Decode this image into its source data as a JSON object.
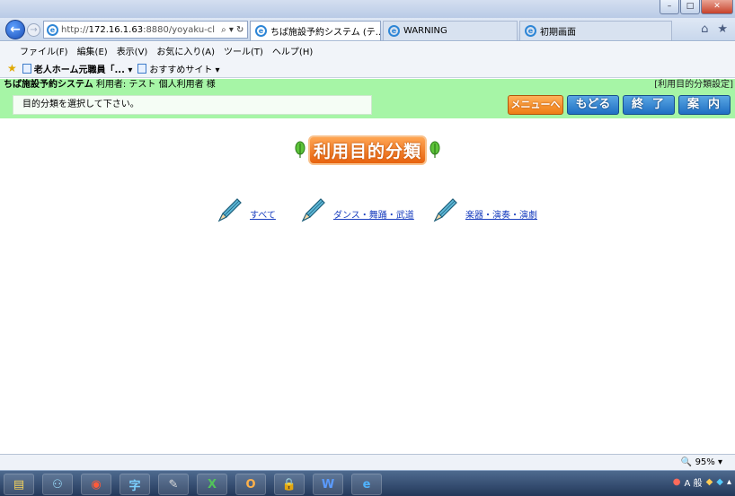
{
  "browser": {
    "address_url_gray": "http://",
    "address_url_host": "172.16.1.63",
    "address_url_rest": ":8880/yoyaku-cl",
    "address_icons": "⌕ ▾ ↻",
    "back_glyph": "←",
    "forward_glyph": "→",
    "tabs": [
      {
        "label": "ちば施設予約システム (テ...",
        "close": "×"
      },
      {
        "label": "WARNING"
      },
      {
        "label": "初期画面"
      }
    ],
    "nav_right_icons": [
      "⌂",
      "★"
    ],
    "window_buttons": [
      "–",
      "□",
      "✕"
    ]
  },
  "menu": {
    "items": [
      "ファイル(F)",
      "編集(E)",
      "表示(V)",
      "お気に入り(A)",
      "ツール(T)",
      "ヘルプ(H)"
    ]
  },
  "favorites": {
    "star": "★",
    "items": [
      "老人ホーム元職員「... ▾",
      "おすすめサイト ▾"
    ]
  },
  "header": {
    "system_name": "ちば施設予約システム",
    "user_text": " 利用者: テスト 個人利用者 様",
    "right_text": "[利用目的分類設定]",
    "instruction": "目的分類を選択して下さい。"
  },
  "buttons": {
    "menu": "メニューへ",
    "back": "もどる",
    "end": "終了",
    "guide": "案内"
  },
  "page_title": "利用目的分類",
  "categories": [
    "すべて",
    "ダンス・舞踊・武道",
    "楽器・演奏・演劇"
  ],
  "status": {
    "zoom": "95%",
    "zoom_icon": "🔍"
  },
  "taskbar": {
    "tray_text": "A 般"
  },
  "colors": {
    "header_green": "#a6f5a6",
    "menu_button_orange": "#ef7c12",
    "nav_button_blue": "#1f6fc3",
    "link_blue": "#1a3fbf"
  }
}
